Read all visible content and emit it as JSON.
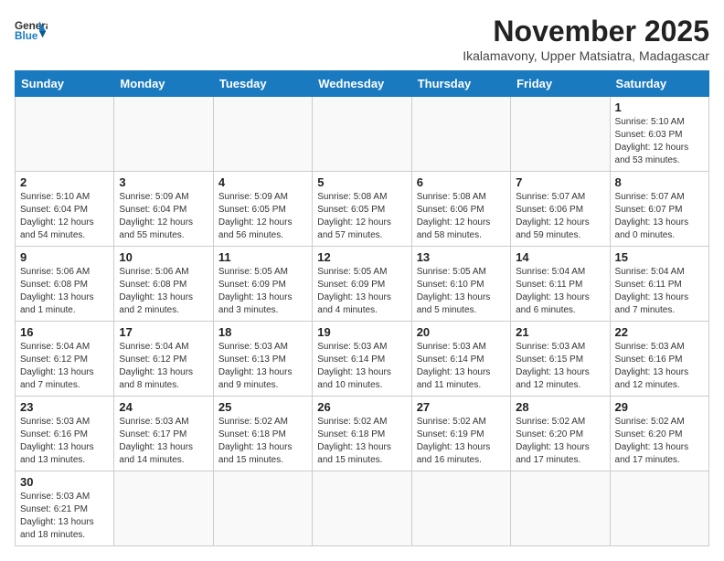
{
  "logo": {
    "text_general": "General",
    "text_blue": "Blue"
  },
  "title": "November 2025",
  "location": "Ikalamavony, Upper Matsiatra, Madagascar",
  "weekdays": [
    "Sunday",
    "Monday",
    "Tuesday",
    "Wednesday",
    "Thursday",
    "Friday",
    "Saturday"
  ],
  "weeks": [
    [
      {
        "day": "",
        "info": ""
      },
      {
        "day": "",
        "info": ""
      },
      {
        "day": "",
        "info": ""
      },
      {
        "day": "",
        "info": ""
      },
      {
        "day": "",
        "info": ""
      },
      {
        "day": "",
        "info": ""
      },
      {
        "day": "1",
        "info": "Sunrise: 5:10 AM\nSunset: 6:03 PM\nDaylight: 12 hours\nand 53 minutes."
      }
    ],
    [
      {
        "day": "2",
        "info": "Sunrise: 5:10 AM\nSunset: 6:04 PM\nDaylight: 12 hours\nand 54 minutes."
      },
      {
        "day": "3",
        "info": "Sunrise: 5:09 AM\nSunset: 6:04 PM\nDaylight: 12 hours\nand 55 minutes."
      },
      {
        "day": "4",
        "info": "Sunrise: 5:09 AM\nSunset: 6:05 PM\nDaylight: 12 hours\nand 56 minutes."
      },
      {
        "day": "5",
        "info": "Sunrise: 5:08 AM\nSunset: 6:05 PM\nDaylight: 12 hours\nand 57 minutes."
      },
      {
        "day": "6",
        "info": "Sunrise: 5:08 AM\nSunset: 6:06 PM\nDaylight: 12 hours\nand 58 minutes."
      },
      {
        "day": "7",
        "info": "Sunrise: 5:07 AM\nSunset: 6:06 PM\nDaylight: 12 hours\nand 59 minutes."
      },
      {
        "day": "8",
        "info": "Sunrise: 5:07 AM\nSunset: 6:07 PM\nDaylight: 13 hours\nand 0 minutes."
      }
    ],
    [
      {
        "day": "9",
        "info": "Sunrise: 5:06 AM\nSunset: 6:08 PM\nDaylight: 13 hours\nand 1 minute."
      },
      {
        "day": "10",
        "info": "Sunrise: 5:06 AM\nSunset: 6:08 PM\nDaylight: 13 hours\nand 2 minutes."
      },
      {
        "day": "11",
        "info": "Sunrise: 5:05 AM\nSunset: 6:09 PM\nDaylight: 13 hours\nand 3 minutes."
      },
      {
        "day": "12",
        "info": "Sunrise: 5:05 AM\nSunset: 6:09 PM\nDaylight: 13 hours\nand 4 minutes."
      },
      {
        "day": "13",
        "info": "Sunrise: 5:05 AM\nSunset: 6:10 PM\nDaylight: 13 hours\nand 5 minutes."
      },
      {
        "day": "14",
        "info": "Sunrise: 5:04 AM\nSunset: 6:11 PM\nDaylight: 13 hours\nand 6 minutes."
      },
      {
        "day": "15",
        "info": "Sunrise: 5:04 AM\nSunset: 6:11 PM\nDaylight: 13 hours\nand 7 minutes."
      }
    ],
    [
      {
        "day": "16",
        "info": "Sunrise: 5:04 AM\nSunset: 6:12 PM\nDaylight: 13 hours\nand 7 minutes."
      },
      {
        "day": "17",
        "info": "Sunrise: 5:04 AM\nSunset: 6:12 PM\nDaylight: 13 hours\nand 8 minutes."
      },
      {
        "day": "18",
        "info": "Sunrise: 5:03 AM\nSunset: 6:13 PM\nDaylight: 13 hours\nand 9 minutes."
      },
      {
        "day": "19",
        "info": "Sunrise: 5:03 AM\nSunset: 6:14 PM\nDaylight: 13 hours\nand 10 minutes."
      },
      {
        "day": "20",
        "info": "Sunrise: 5:03 AM\nSunset: 6:14 PM\nDaylight: 13 hours\nand 11 minutes."
      },
      {
        "day": "21",
        "info": "Sunrise: 5:03 AM\nSunset: 6:15 PM\nDaylight: 13 hours\nand 12 minutes."
      },
      {
        "day": "22",
        "info": "Sunrise: 5:03 AM\nSunset: 6:16 PM\nDaylight: 13 hours\nand 12 minutes."
      }
    ],
    [
      {
        "day": "23",
        "info": "Sunrise: 5:03 AM\nSunset: 6:16 PM\nDaylight: 13 hours\nand 13 minutes."
      },
      {
        "day": "24",
        "info": "Sunrise: 5:03 AM\nSunset: 6:17 PM\nDaylight: 13 hours\nand 14 minutes."
      },
      {
        "day": "25",
        "info": "Sunrise: 5:02 AM\nSunset: 6:18 PM\nDaylight: 13 hours\nand 15 minutes."
      },
      {
        "day": "26",
        "info": "Sunrise: 5:02 AM\nSunset: 6:18 PM\nDaylight: 13 hours\nand 15 minutes."
      },
      {
        "day": "27",
        "info": "Sunrise: 5:02 AM\nSunset: 6:19 PM\nDaylight: 13 hours\nand 16 minutes."
      },
      {
        "day": "28",
        "info": "Sunrise: 5:02 AM\nSunset: 6:20 PM\nDaylight: 13 hours\nand 17 minutes."
      },
      {
        "day": "29",
        "info": "Sunrise: 5:02 AM\nSunset: 6:20 PM\nDaylight: 13 hours\nand 17 minutes."
      }
    ],
    [
      {
        "day": "30",
        "info": "Sunrise: 5:03 AM\nSunset: 6:21 PM\nDaylight: 13 hours\nand 18 minutes."
      },
      {
        "day": "",
        "info": ""
      },
      {
        "day": "",
        "info": ""
      },
      {
        "day": "",
        "info": ""
      },
      {
        "day": "",
        "info": ""
      },
      {
        "day": "",
        "info": ""
      },
      {
        "day": "",
        "info": ""
      }
    ]
  ]
}
